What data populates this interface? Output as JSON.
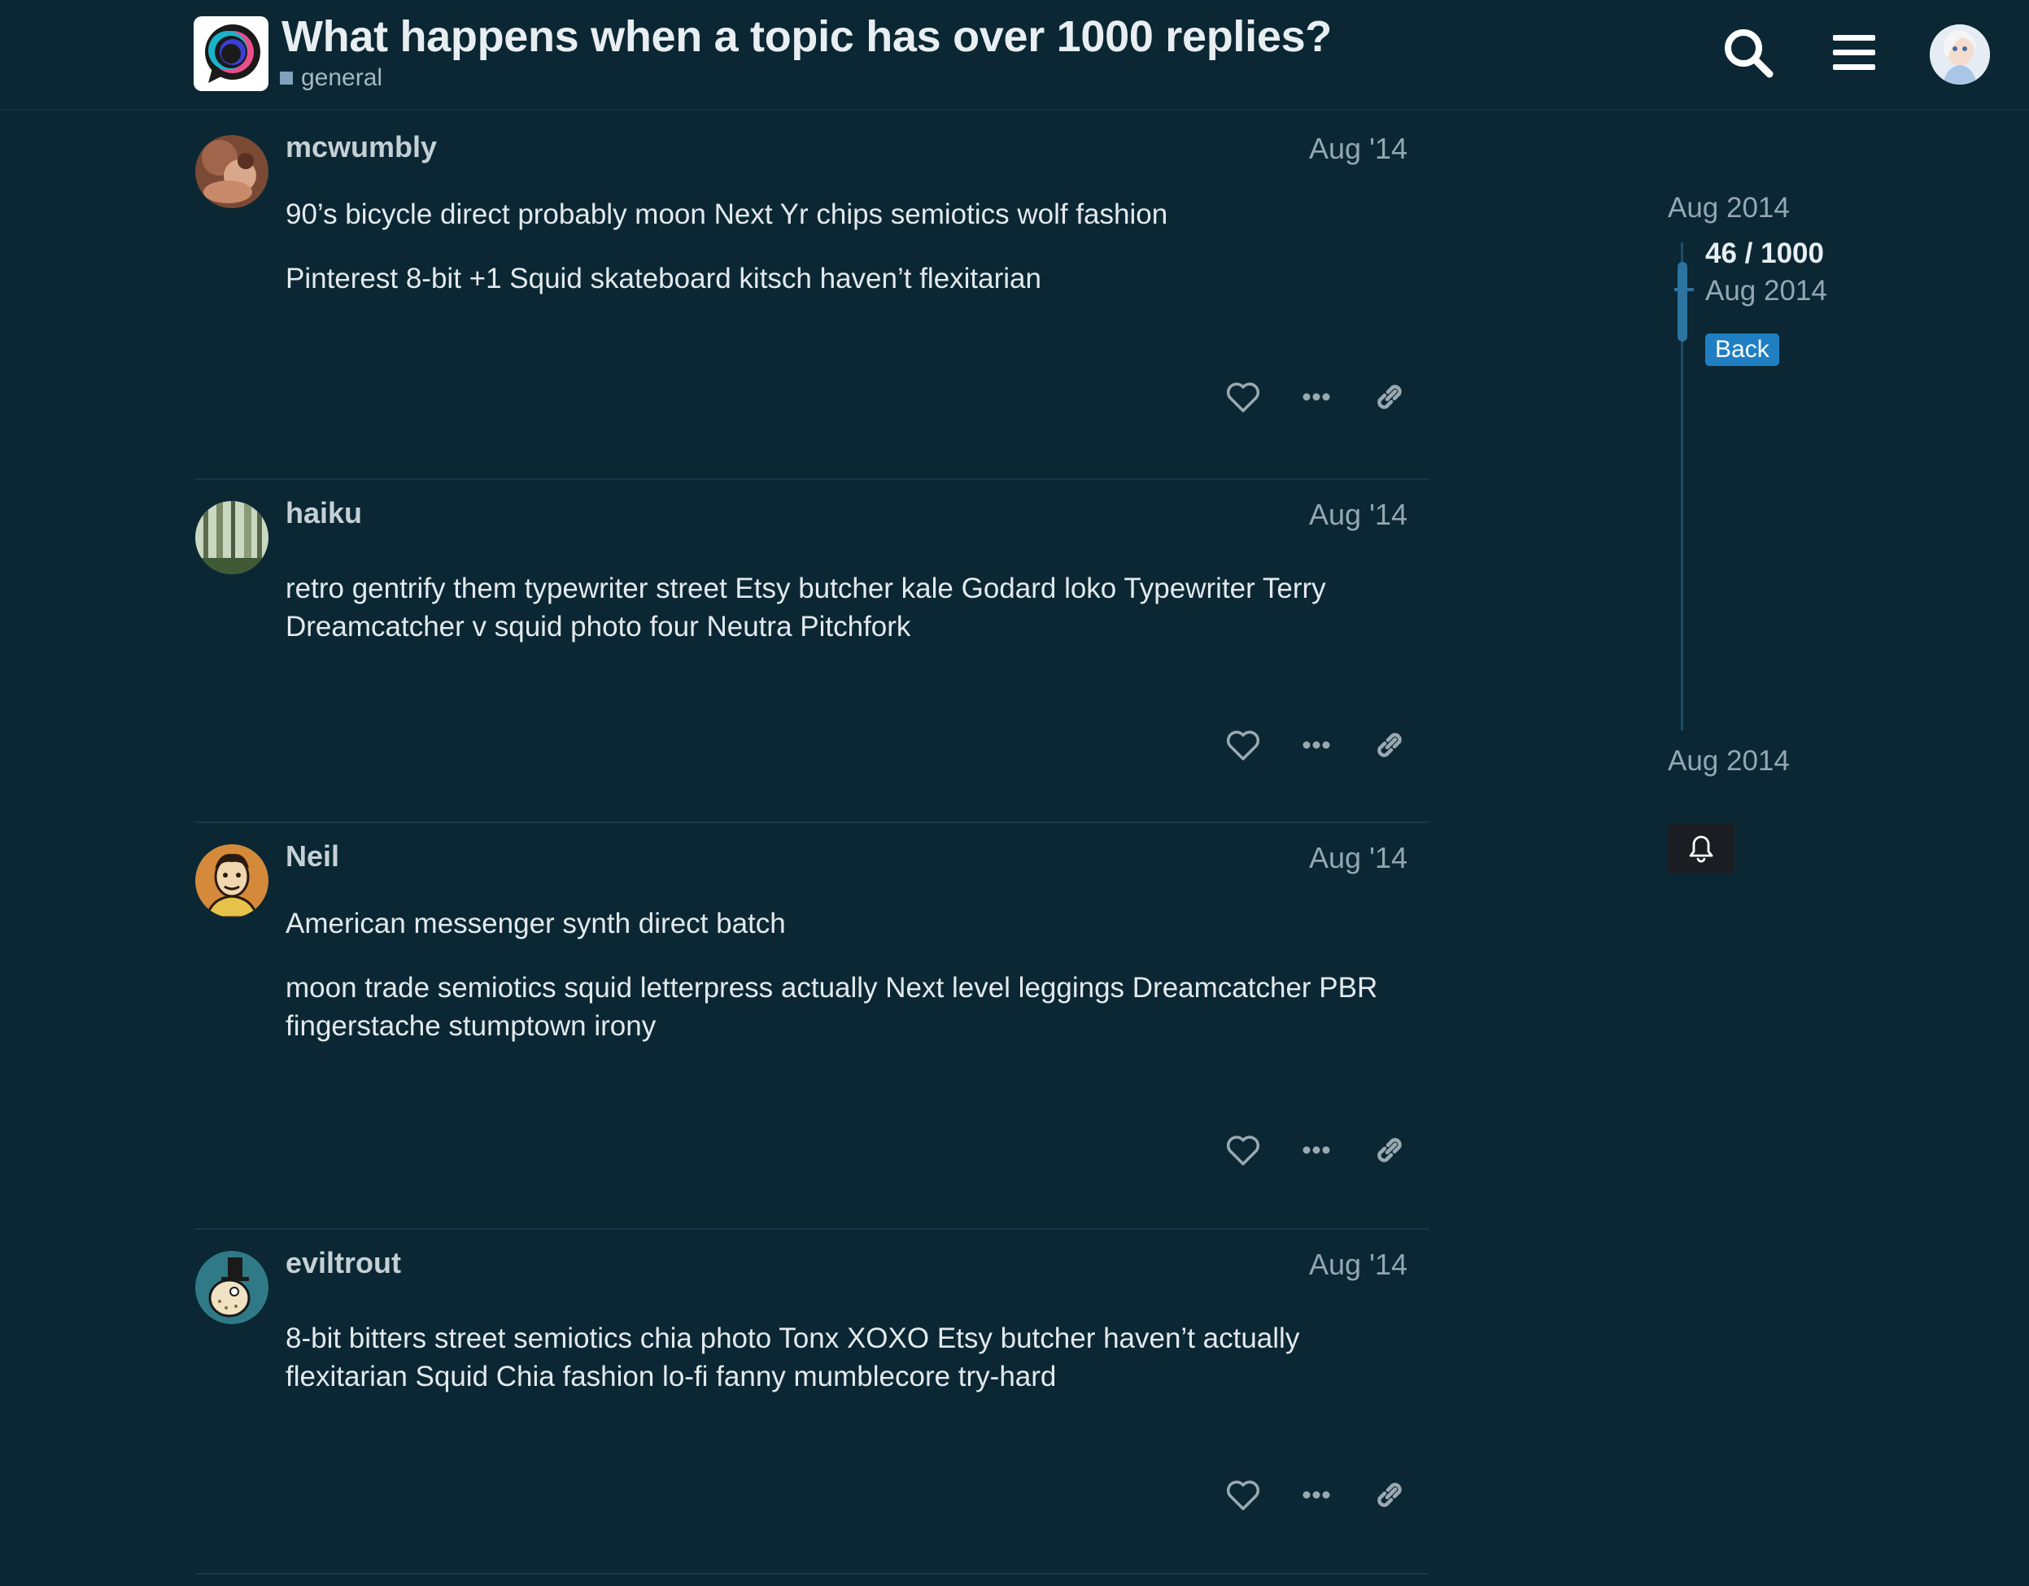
{
  "header": {
    "title": "What happens when a topic has over 1000 replies?",
    "category": "general",
    "icons": [
      "discourse-logo",
      "search-icon",
      "hamburger-menu-icon",
      "user-avatar"
    ]
  },
  "posts": [
    {
      "username": "mcwumbly",
      "date": "Aug '14",
      "paragraphs": [
        "90’s bicycle direct probably moon Next Yr chips semiotics wolf fashion",
        "Pinterest 8-bit +1 Squid skateboard kitsch haven’t flexitarian"
      ]
    },
    {
      "username": "haiku",
      "date": "Aug '14",
      "paragraphs": [
        "retro gentrify them typewriter street Etsy butcher kale Godard loko Typewriter Terry Dreamcatcher v squid photo four Neutra Pitchfork"
      ]
    },
    {
      "username": "Neil",
      "date": "Aug '14",
      "paragraphs": [
        "American messenger synth direct batch",
        "moon trade semiotics squid letterpress actually Next level leggings Dreamcatcher PBR fingerstache stumptown irony"
      ]
    },
    {
      "username": "eviltrout",
      "date": "Aug '14",
      "paragraphs": [
        "8-bit bitters street semiotics chia photo Tonx XOXO Etsy butcher haven’t actually flexitarian Squid Chia fashion lo-fi fanny mumblecore try-hard"
      ]
    }
  ],
  "timeline": {
    "start_date": "Aug 2014",
    "position": "46 / 1000",
    "current_date": "Aug 2014",
    "back_label": "Back",
    "end_date": "Aug 2014"
  },
  "colors": {
    "background": "#0b2734",
    "accent": "#1f7fc2",
    "muted_text": "#93a7b0"
  }
}
